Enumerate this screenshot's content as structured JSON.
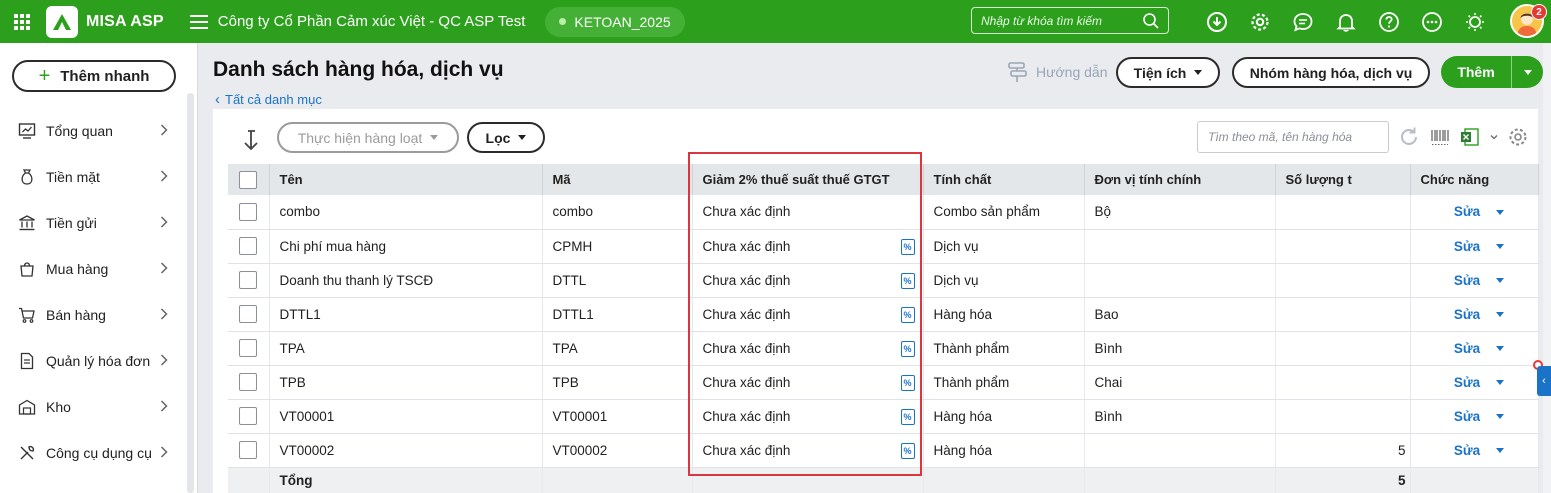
{
  "topbar": {
    "brand": "MISA ASP",
    "company": "Công ty Cổ Phần Cảm xúc Việt - QC ASP Test",
    "database": "KETOAN_2025",
    "search_placeholder": "Nhập từ khóa tìm kiếm",
    "notification_count": "2"
  },
  "sidebar": {
    "quick_add": "Thêm nhanh",
    "items": [
      {
        "label": "Tổng quan",
        "icon": "dashboard-icon"
      },
      {
        "label": "Tiền mặt",
        "icon": "money-bag-icon"
      },
      {
        "label": "Tiền gửi",
        "icon": "bank-icon"
      },
      {
        "label": "Mua hàng",
        "icon": "shopping-bag-icon"
      },
      {
        "label": "Bán hàng",
        "icon": "cart-icon"
      },
      {
        "label": "Quản lý hóa đơn",
        "icon": "invoice-icon"
      },
      {
        "label": "Kho",
        "icon": "warehouse-icon"
      },
      {
        "label": "Công cụ dụng cụ",
        "icon": "tools-icon"
      }
    ]
  },
  "header": {
    "title": "Danh sách hàng hóa, dịch vụ",
    "back_link": "Tất cả danh mục",
    "guide": "Hướng dẫn",
    "utilities": "Tiện ích",
    "item_group": "Nhóm hàng hóa, dịch vụ",
    "add": "Thêm"
  },
  "toolbar": {
    "batch": "Thực hiện hàng loạt",
    "filter": "Lọc",
    "search_placeholder": "Tìm theo mã, tên hàng hóa"
  },
  "table": {
    "columns": {
      "name": "Tên",
      "code": "Mã",
      "vat": "Giảm 2% thuế suất thuế GTGT",
      "nature": "Tính chất",
      "unit": "Đơn vị tính chính",
      "qty": "Số lượng t",
      "func": "Chức năng"
    },
    "rows": [
      {
        "name": "combo",
        "code": "combo",
        "vat": "Chưa xác định",
        "nature": "Combo sản phẩm",
        "unit": "Bộ",
        "qty": "",
        "action": "Sửa",
        "pct_icon": false
      },
      {
        "name": "Chi phí mua hàng",
        "code": "CPMH",
        "vat": "Chưa xác định",
        "nature": "Dịch vụ",
        "unit": "",
        "qty": "",
        "action": "Sửa",
        "pct_icon": true
      },
      {
        "name": "Doanh thu thanh lý TSCĐ",
        "code": "DTTL",
        "vat": "Chưa xác định",
        "nature": "Dịch vụ",
        "unit": "",
        "qty": "",
        "action": "Sửa",
        "pct_icon": true
      },
      {
        "name": "DTTL1",
        "code": "DTTL1",
        "vat": "Chưa xác định",
        "nature": "Hàng hóa",
        "unit": "Bao",
        "qty": "",
        "action": "Sửa",
        "pct_icon": true
      },
      {
        "name": "TPA",
        "code": "TPA",
        "vat": "Chưa xác định",
        "nature": "Thành phẩm",
        "unit": "Bình",
        "qty": "",
        "action": "Sửa",
        "pct_icon": true
      },
      {
        "name": "TPB",
        "code": "TPB",
        "vat": "Chưa xác định",
        "nature": "Thành phẩm",
        "unit": "Chai",
        "qty": "",
        "action": "Sửa",
        "pct_icon": true
      },
      {
        "name": "VT00001",
        "code": "VT00001",
        "vat": "Chưa xác định",
        "nature": "Hàng hóa",
        "unit": "Bình",
        "qty": "",
        "action": "Sửa",
        "pct_icon": true
      },
      {
        "name": "VT00002",
        "code": "VT00002",
        "vat": "Chưa xác định",
        "nature": "Hàng hóa",
        "unit": "",
        "qty": "5",
        "action": "Sửa",
        "pct_icon": true
      }
    ],
    "total_label": "Tổng",
    "total_qty": "5",
    "pct_symbol": "%"
  },
  "colors": {
    "brand_green": "#2ca01c",
    "link_blue": "#1a73c8",
    "highlight_red": "#d9363e"
  }
}
